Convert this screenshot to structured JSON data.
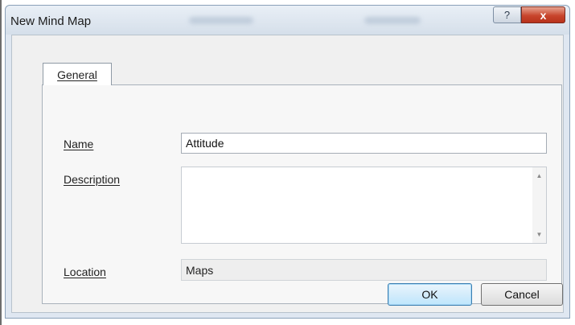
{
  "window": {
    "title": "New Mind Map",
    "help_glyph": "?",
    "close_glyph": "x"
  },
  "tabs": [
    {
      "label": "General",
      "selected": true
    }
  ],
  "form": {
    "name_label": "Name",
    "name_value": "Attitude",
    "description_label": "Description",
    "description_value": "",
    "location_label": "Location",
    "location_value": "Maps"
  },
  "buttons": {
    "ok_label": "OK",
    "cancel_label": "Cancel"
  },
  "icons": {
    "scroll_up": "scroll-up-arrow-icon",
    "scroll_down": "scroll-down-arrow-icon"
  },
  "colors": {
    "close_button": "#c8452c",
    "default_button_border": "#3c7fb1"
  }
}
